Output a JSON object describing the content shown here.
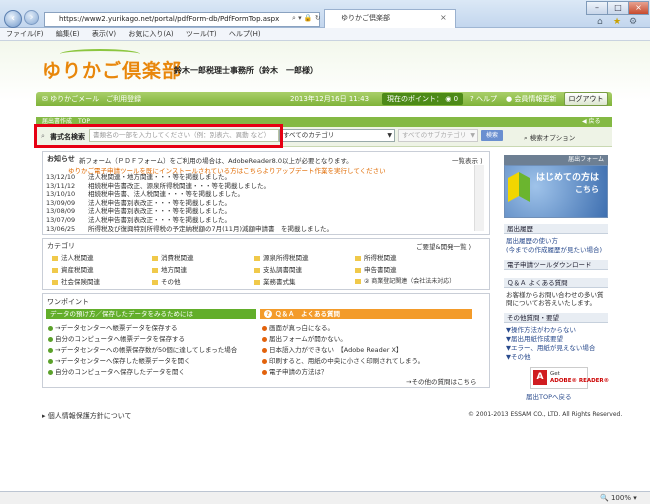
{
  "browser": {
    "url": "https://www2.yurikago.net/portal/pdfForm-db/PdfFormTop.aspx",
    "tab_title": "ゆりかご倶楽部",
    "menu": [
      "ファイル(F)",
      "編集(E)",
      "表示(V)",
      "お気に入り(A)",
      "ツール(T)",
      "ヘルプ(H)"
    ],
    "zoom": "100%"
  },
  "header": {
    "logo": "ゆりかご倶楽部",
    "firm": "鈴木一郎税理士事務所（鈴木　一郎様）",
    "mail_link": "ゆりかごメール　ご利用登録",
    "datetime": "2013年12月16日 11:43",
    "points_label": "現在のポイント：",
    "points_value": "0",
    "help": "ヘルプ",
    "member_update": "会員情報更新",
    "logout": "ログアウト"
  },
  "nav": {
    "section": "届出書作成　TOP",
    "back": "戻る"
  },
  "search": {
    "label": "書式名検索",
    "placeholder": "書類名の一部を入力してください（例：別表六、異動 など）",
    "category": "すべてのカテゴリ",
    "subcategory": "すべてのサブカテゴリ",
    "button": "検索",
    "options": "検索オプション"
  },
  "news": {
    "title": "お知らせ",
    "notice": "新フォーム（ＰＤＦフォーム）をご利用の場合は、AdobeReader8.0以上が必要となります。",
    "list_link": "一覧表示",
    "highlight": "ゆりかご電子申請ツールを既にインストールされている方はこちらよりアップデート作業を実行してください",
    "items": [
      {
        "date": "13/12/10",
        "text": "法人税関連・地方関連・・・等を掲載しました。"
      },
      {
        "date": "13/11/12",
        "text": "相続税申告書改正、源泉所得税関連・・・等を掲載しました。"
      },
      {
        "date": "13/10/10",
        "text": "相続税申告書、法人税関連・・・等を掲載しました。"
      },
      {
        "date": "13/09/09",
        "text": "法人税申告書別表改正・・・等を掲載しました。"
      },
      {
        "date": "13/08/09",
        "text": "法人税申告書別表改正・・・等を掲載しました。"
      },
      {
        "date": "13/07/09",
        "text": "法人税申告書別表改正・・・等を掲載しました。"
      },
      {
        "date": "13/06/25",
        "text": "所得税及び復興特別所得税の予定納税額の7月(11月)減額申請書　を掲載しました。"
      }
    ]
  },
  "categories": {
    "title": "カテゴリ",
    "edit": "ご要望&開発一覧",
    "items": [
      "法人税関連",
      "消費税関連",
      "源泉所得税関連",
      "所得税関連",
      "資産税関連",
      "地方関連",
      "支払調書関連",
      "申告書関連",
      "社会保険関連",
      "その他",
      "業務書式集",
      "② 商業登記関連（会社法未対応）"
    ]
  },
  "onepoint": {
    "title": "ワンポイント",
    "left_header": "データの預け方／保存したデータをみるためには",
    "left_items": [
      "データセンターへ帳票データを保存する",
      "自分のコンピュータへ帳票データを保存する",
      "データセンターへの帳票保存数が50個に達してしまった場合",
      "データセンターへ保存した帳票データを開く",
      "自分のコンピュータへ保存したデータを開く"
    ],
    "right_header": "Ｑ＆Ａ　よくある質問",
    "right_items": [
      "画面が真っ白になる。",
      "届出フォームが開かない。",
      "日本語入力ができない　【Adobe Reader X】",
      "印刷すると、用紙の中央に小さく印刷されてしまう。",
      "電子申請の方法は？"
    ],
    "more": "→その他の質問はこちら"
  },
  "sidebar": {
    "banner_title": "届出フォーム",
    "banner_text1": "はじめての方は",
    "banner_text2": "こちら",
    "history": "届出履歴",
    "history_links": [
      "届出履歴の使い方",
      "(今までの作成履歴が見たい場合)"
    ],
    "download": "電子申請ツールダウンロード",
    "faq": "Ｑ＆Ａ よくある質問",
    "faq_text": "お客様からお問い合わせの多い質問についてお答えいたします。",
    "request": "その他質問・要望",
    "request_links": [
      "▼操作方法がわからない",
      "▼届出用紙作成要望",
      "▼エラー、用紙が見えない場合",
      "▼その他"
    ],
    "adobe_get": "Get",
    "adobe_name": "ADOBE® READER®",
    "back_top": "届出TOPへ戻る"
  },
  "footer": {
    "privacy": "個人情報保護方針について",
    "copyright": "© 2001-2013 ESSAM CO., LTD. All Rights Reserved."
  }
}
